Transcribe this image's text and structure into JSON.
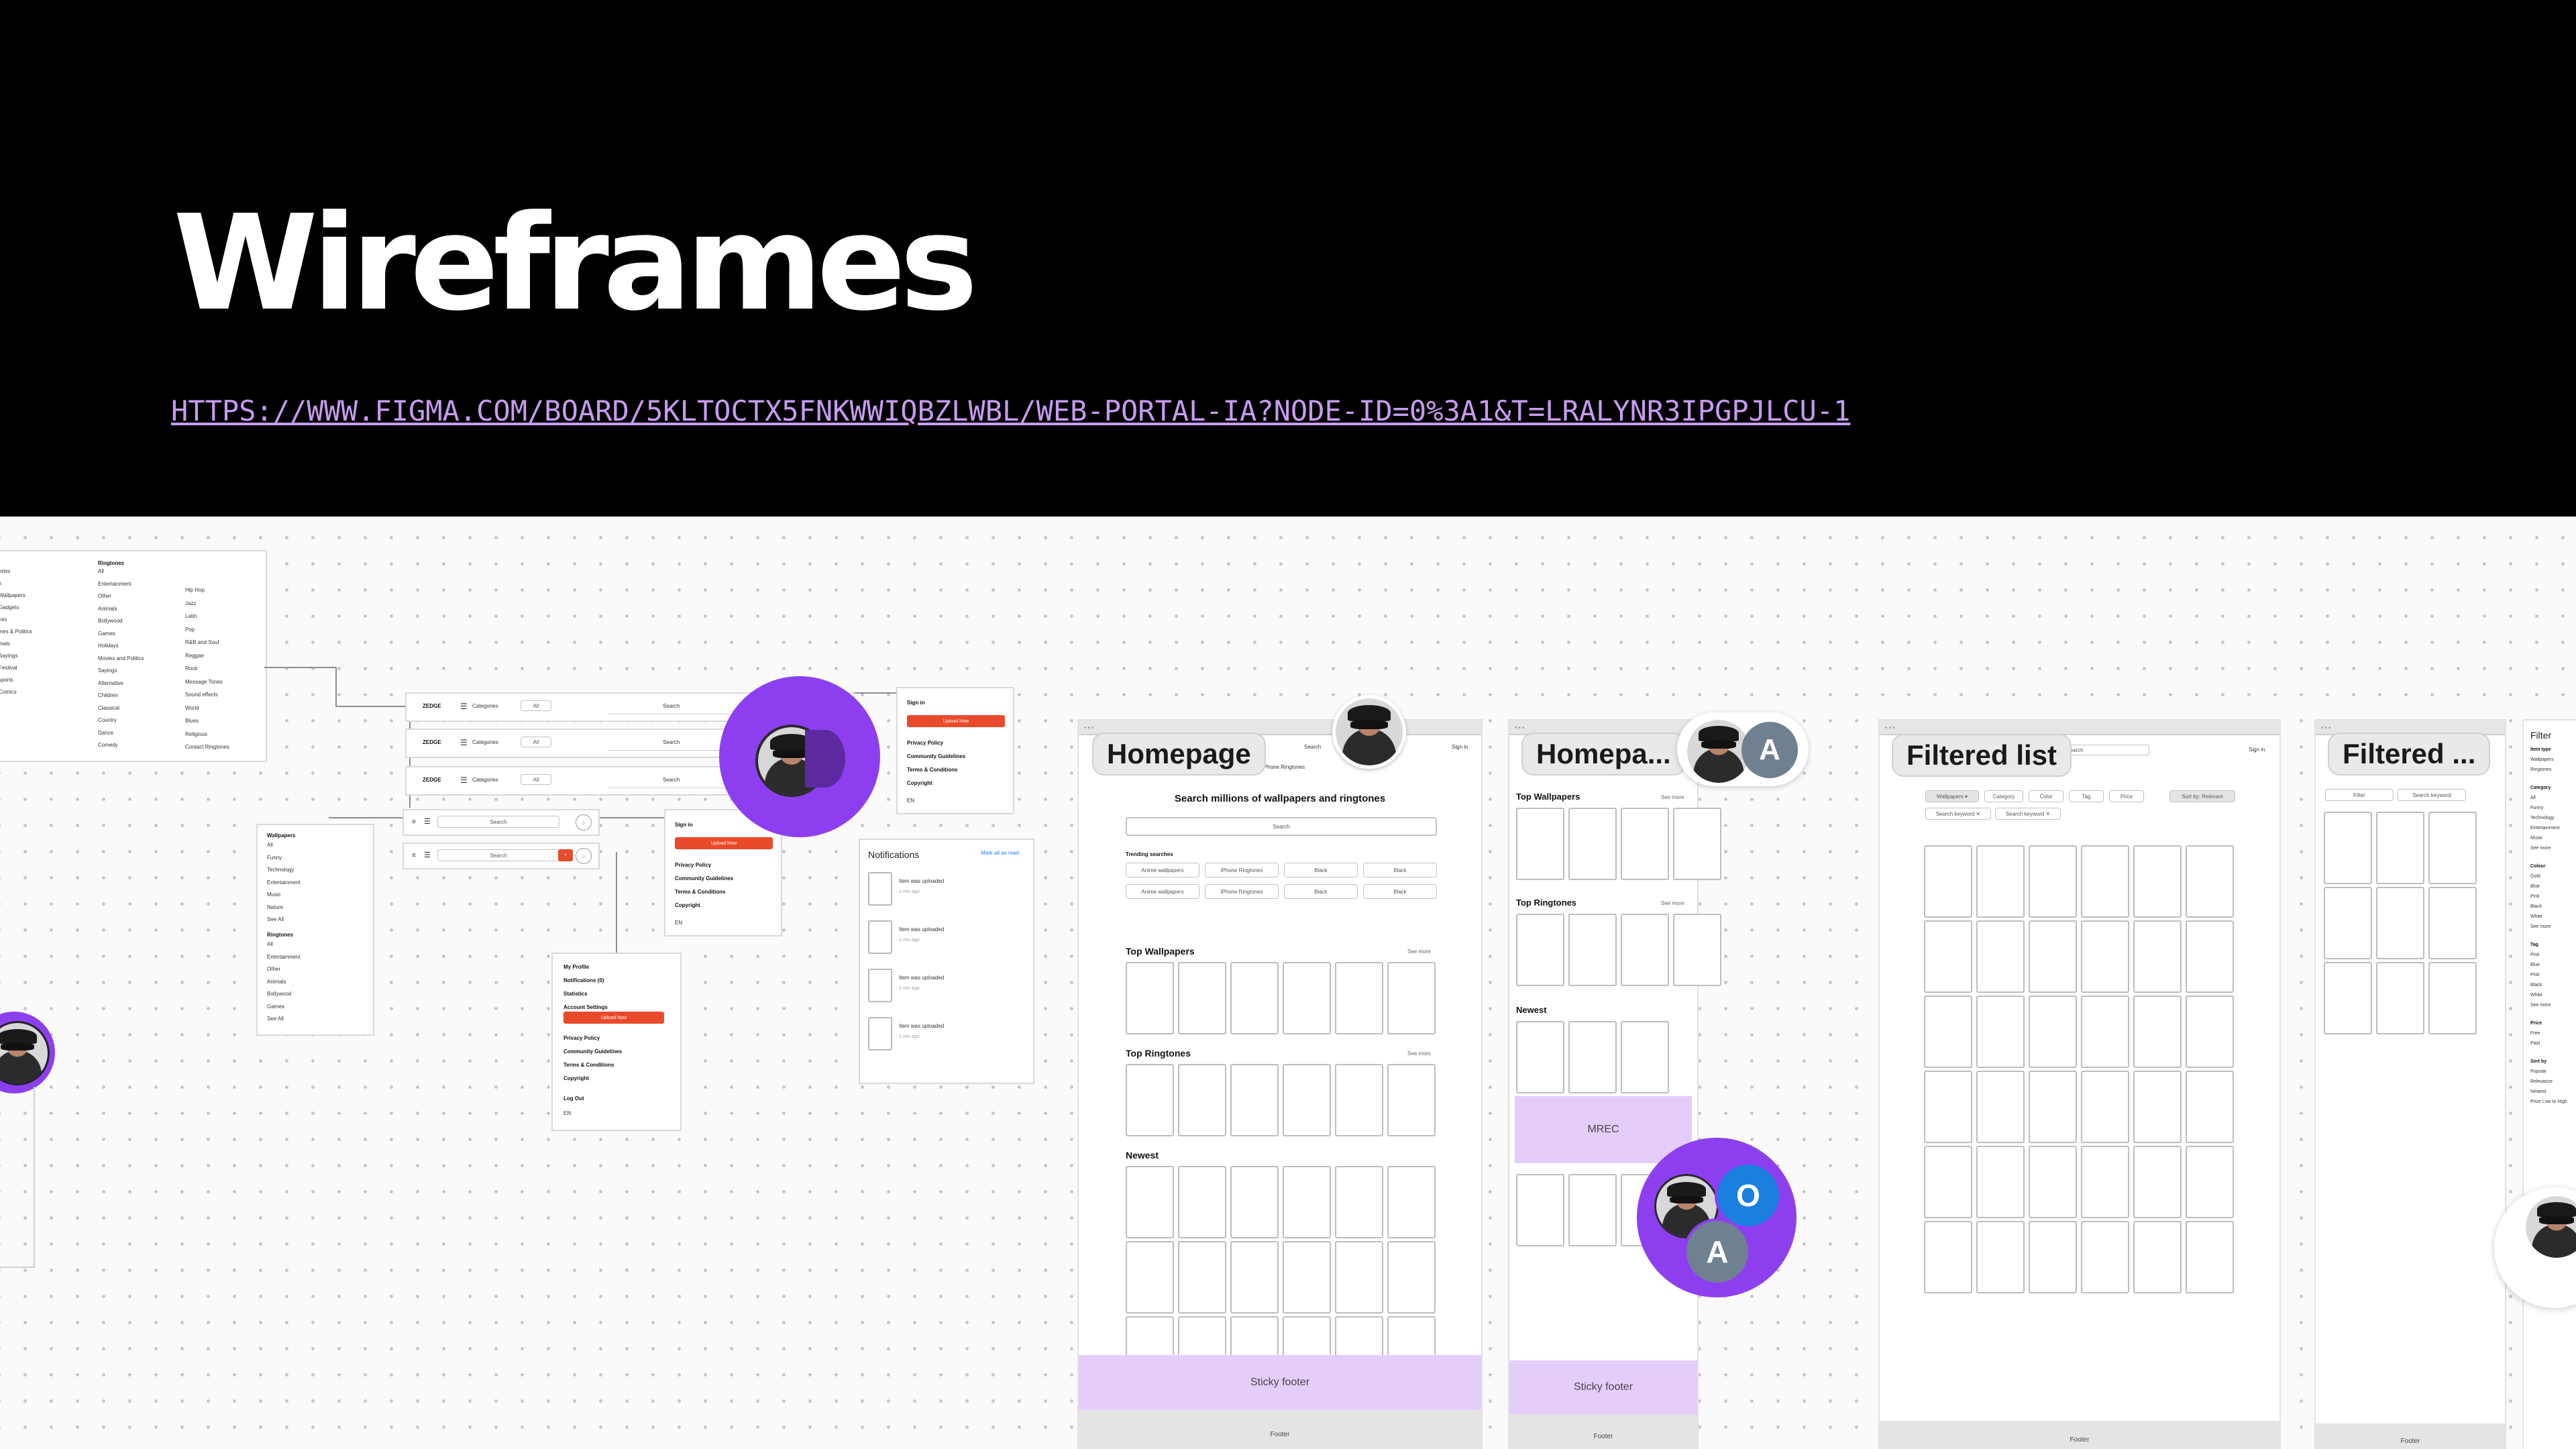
{
  "slide": {
    "title": "Wireframes",
    "link": "HTTPS://WWW.FIGMA.COM/BOARD/5KLTOCTX5FNKWWIQBZLWBL/WEB-PORTAL-IA?NODE-ID=0%3A1&T=LRALYNR3IPGPJLCU-1"
  },
  "colors": {
    "background": "#000000",
    "link": "#c79bf0",
    "accent_purple": "#8d3ff0",
    "sticky_footer": "#e5cdfb",
    "cta_red": "#e84b2b"
  },
  "sitemap": {
    "ringtones_heading": "Ringtones",
    "col1": [
      "All",
      "Entertainment",
      "Other",
      "Animals",
      "Bollywood",
      "Games",
      "Holidays",
      "Movies and Politics",
      "Sayings",
      "Alternative",
      "Children",
      "Classical",
      "Country",
      "Dance",
      "Comedy"
    ],
    "col2": [
      "Hip Hop",
      "Jazz",
      "Latin",
      "Pop",
      "R&B and Soul",
      "Reggae",
      "Rock",
      "Message Tones",
      "Sound effects",
      "World",
      "Blues",
      "Religious",
      "Contact Ringtones"
    ],
    "left_edge": [
      "ories",
      "s",
      "Wallpapers",
      "Gadgets",
      "ces",
      "ines & Politics",
      "mals",
      "Sayings",
      "Festival",
      "sports",
      "Comics"
    ]
  },
  "nav_rows": [
    {
      "logo": "ZEDGE",
      "categories": "Categories",
      "filter": "All",
      "search": "Search"
    },
    {
      "logo": "ZEDGE",
      "categories": "Categories",
      "filter": "All",
      "search": "Search"
    },
    {
      "logo": "ZEDGE",
      "categories": "Categories",
      "filter": "All",
      "search": "Search"
    }
  ],
  "mobile_rows": [
    {
      "search": "Search"
    },
    {
      "search": "Search"
    }
  ],
  "signin_menu_1": {
    "sign_in": "Sign in",
    "button": "Upload Now",
    "items": [
      "Privacy Policy",
      "Community Guidelines",
      "Terms & Conditions",
      "Copyright"
    ],
    "lang": "EN"
  },
  "signin_menu_2": {
    "sign_in": "Sign in",
    "button": "Upload Now",
    "items": [
      "Privacy Policy",
      "Community Guidelines",
      "Terms & Conditions",
      "Copyright"
    ],
    "lang": "EN"
  },
  "categories_dropdown": {
    "wallpapers_heading": "Wallpapers",
    "wallpapers": [
      "All",
      "Funny",
      "Technology",
      "Entertainment",
      "Music",
      "Nature",
      "See All"
    ],
    "ringtones_heading": "Ringtones",
    "ringtones": [
      "All",
      "Entertainment",
      "Other",
      "Animals",
      "Bollywood",
      "Games",
      "See All"
    ]
  },
  "profile_menu": {
    "items": [
      "My Profile",
      "Notifications (0)",
      "Statistics",
      "Account Settings"
    ],
    "button": "Upload Now",
    "links": [
      "Privacy Policy",
      "Community Guidelines",
      "Terms & Conditions",
      "Copyright"
    ],
    "logout": "Log Out",
    "lang": "EN"
  },
  "notifications": {
    "title": "Notifications",
    "mark_read": "Mark all as read",
    "items": [
      {
        "text": "Item was uploaded",
        "time": "1 min ago"
      },
      {
        "text": "Item was uploaded",
        "time": "1 min ago"
      },
      {
        "text": "Item was uploaded",
        "time": "1 min ago"
      },
      {
        "text": "Item was uploaded",
        "time": "1 min ago"
      }
    ]
  },
  "homepage_desktop": {
    "label": "Homepage",
    "search_top": "Search",
    "nav_sample": "iPhone Ringtones",
    "sign_in": "Sign in",
    "hero": "Search millions of wallpapers and ringtones",
    "search": "Search",
    "trending_title": "Trending searches",
    "trending": [
      "Anime wallpapers",
      "iPhone Ringtones",
      "Black",
      "Black",
      "Anime wallpapers",
      "iPhone Ringtones",
      "Black",
      "Black"
    ],
    "sections": [
      {
        "title": "Top Wallpapers",
        "more": "See more"
      },
      {
        "title": "Top Ringtones",
        "more": "See more"
      },
      {
        "title": "Newest",
        "more": ""
      }
    ],
    "sticky_footer": "Sticky footer",
    "footer": "Footer"
  },
  "homepage_mobile": {
    "label": "Homepa...",
    "sections": [
      {
        "title": "Top Wallpapers",
        "more": "See more"
      },
      {
        "title": "Top Ringtones",
        "more": "See more"
      },
      {
        "title": "Newest",
        "more": ""
      }
    ],
    "mrec": "MREC",
    "sticky_footer": "Sticky footer",
    "footer": "Footer"
  },
  "filtered_desktop": {
    "label": "Filtered list",
    "search": "Search",
    "sign_in": "Sign in",
    "filters": [
      "Wallpapers",
      "Category",
      "Color",
      "Tag",
      "Price"
    ],
    "sort": "Sort by: Relevant",
    "keywords": [
      "Search keyword",
      "Search keyword"
    ],
    "footer": "Footer"
  },
  "filtered_mobile": {
    "label": "Filtered ...",
    "filter_btn": "Filter",
    "keyword": "Search keyword",
    "footer": "Footer"
  },
  "filter_panel": {
    "title": "Filter",
    "item_type_heading": "Item type",
    "item_types": [
      "Wallpapers",
      "Ringtones"
    ],
    "category_heading": "Category",
    "categories": [
      "All",
      "Funny",
      "Technology",
      "Entertainment",
      "Music",
      "See more"
    ],
    "colour_heading": "Colour",
    "colours": [
      "Gold",
      "Blue",
      "Pink",
      "Black",
      "White",
      "See more"
    ],
    "tag_heading": "Tag",
    "tags": [
      "Pink",
      "Blue",
      "Pink",
      "Black",
      "White",
      "See more"
    ],
    "price_heading": "Price",
    "prices": [
      "Free",
      "Paid"
    ],
    "sort_heading": "Sort by",
    "sorts": [
      "Popular",
      "Relevance",
      "Newest",
      "Price Low to High"
    ]
  },
  "presence": {
    "avatars": [
      "A",
      "O",
      "A"
    ]
  }
}
